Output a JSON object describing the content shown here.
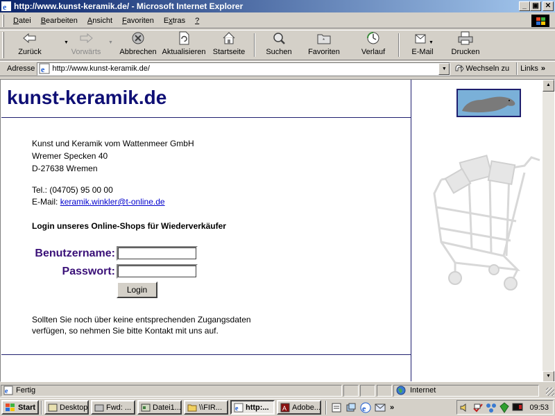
{
  "window": {
    "title": "http://www.kunst-keramik.de/ - Microsoft Internet Explorer",
    "controls": {
      "minimize": "_",
      "maximize": "▣",
      "close": "✕"
    }
  },
  "menu": [
    {
      "label": "Datei",
      "accel": "D",
      "rest": "atei"
    },
    {
      "label": "Bearbeiten",
      "accel": "B",
      "rest": "earbeiten"
    },
    {
      "label": "Ansicht",
      "accel": "A",
      "rest": "nsicht"
    },
    {
      "label": "Favoriten",
      "accel": "F",
      "rest": "avoriten"
    },
    {
      "label": "Extras",
      "accel": "x",
      "pre": "E",
      "rest": "tras"
    },
    {
      "label": "?",
      "accel": "?",
      "rest": ""
    }
  ],
  "toolbar": {
    "back": "Zurück",
    "forward": "Vorwärts",
    "stop": "Abbrechen",
    "refresh": "Aktualisieren",
    "home": "Startseite",
    "search": "Suchen",
    "favorites": "Favoriten",
    "history": "Verlauf",
    "mail": "E-Mail",
    "print": "Drucken"
  },
  "address": {
    "label": "Adresse",
    "url": "http://www.kunst-keramik.de/",
    "go": "Wechseln zu",
    "links": "Links",
    "links_chevron": "»"
  },
  "page": {
    "site_title": "kunst-keramik.de",
    "company": "Kunst und Keramik vom Wattenmeer GmbH",
    "street": "Wremer Specken 40",
    "city": "D-27638 Wremen",
    "phone": "Tel.: (04705) 95 00 00",
    "email_label": "E-Mail:",
    "email": "keramik.winkler@t-online.de",
    "login_heading": "Login unseres Online-Shops für Wiederverkäufer",
    "username_label": "Benutzername:",
    "password_label": "Passwort:",
    "username_value": "",
    "password_value": "",
    "login_button": "Login",
    "info_text": "Sollten Sie noch über keine entsprechenden Zugangsdaten verfügen, so nehmen Sie bitte Kontakt mit uns auf."
  },
  "status": {
    "text": "Fertig",
    "zone": "Internet"
  },
  "taskbar": {
    "start": "Start",
    "tasks": [
      {
        "label": "Desktop",
        "active": false
      },
      {
        "label": "Fwd: ...",
        "active": false
      },
      {
        "label": "Datei1...",
        "active": false
      },
      {
        "label": "\\\\FIR...",
        "active": false
      },
      {
        "label": "http:...",
        "active": true
      },
      {
        "label": "Adobe...",
        "active": false
      }
    ],
    "tray_chevron": "»",
    "clock": "09:53"
  },
  "colors": {
    "title_blue": "#0f0f75",
    "label_purple": "#3a1078",
    "link": "#0000cc",
    "titlebar_start": "#0a246a",
    "titlebar_end": "#a6caf0"
  }
}
